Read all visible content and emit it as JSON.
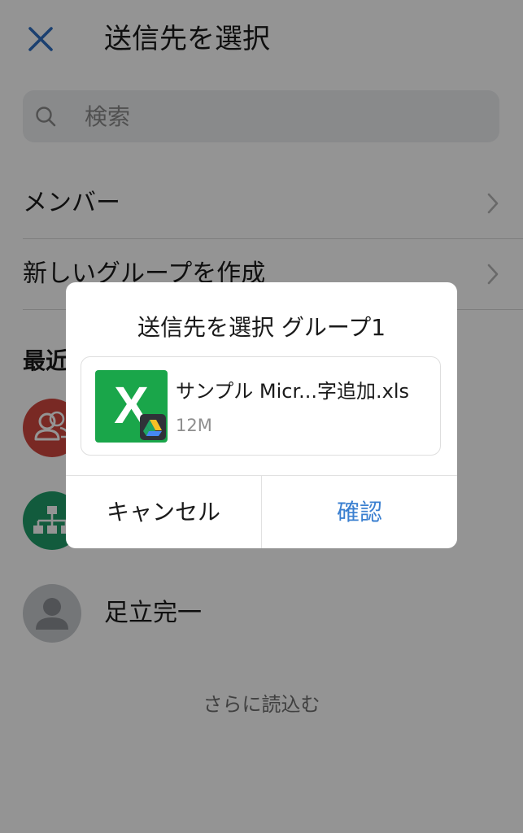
{
  "header": {
    "title": "送信先を選択",
    "close_icon": "close-icon"
  },
  "search": {
    "placeholder": "検索"
  },
  "menu": {
    "members": "メンバー",
    "new_group": "新しいグループを作成"
  },
  "recent": {
    "section_title": "最近",
    "contacts": [
      {
        "name": "",
        "avatar_color": "#d0473f",
        "icon": "group-people-icon"
      },
      {
        "name": "",
        "avatar_color": "#1f9e6a",
        "icon": "org-chart-icon"
      },
      {
        "name": "足立完一",
        "avatar_color": "#c9cbcf",
        "icon": "person-icon"
      }
    ]
  },
  "load_more": "さらに読込む",
  "dialog": {
    "title": "送信先を選択 グループ1",
    "file": {
      "name": "サンプル Micr...字追加.xls",
      "size": "12M",
      "icon": "excel-file-icon",
      "badge": "google-drive-icon"
    },
    "cancel": "キャンセル",
    "confirm": "確認"
  },
  "colors": {
    "accent": "#3a7fd0",
    "excel_green": "#1aa64a",
    "overlay": "rgba(0,0,0,0.42)"
  }
}
